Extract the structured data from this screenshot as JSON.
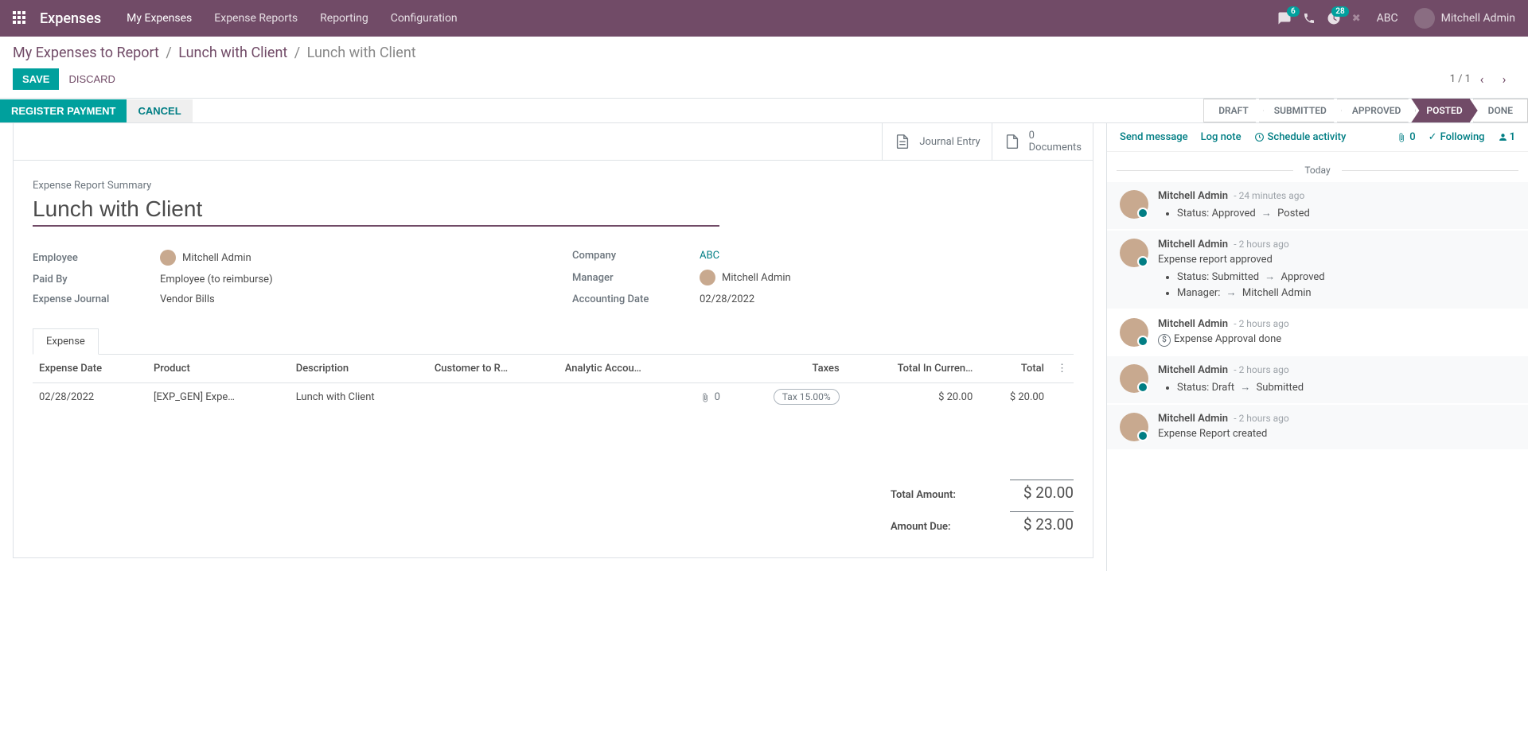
{
  "topnav": {
    "brand": "Expenses",
    "menu": [
      "My Expenses",
      "Expense Reports",
      "Reporting",
      "Configuration"
    ],
    "chat_badge": "6",
    "clock_badge": "28",
    "company": "ABC",
    "user": "Mitchell Admin"
  },
  "breadcrumb": {
    "root": "My Expenses to Report",
    "mid": "Lunch with Client",
    "current": "Lunch with Client"
  },
  "actions": {
    "save": "SAVE",
    "discard": "DISCARD",
    "pager": "1 / 1"
  },
  "statusbar": {
    "register": "REGISTER PAYMENT",
    "cancel": "CANCEL",
    "stages": [
      "DRAFT",
      "SUBMITTED",
      "APPROVED",
      "POSTED",
      "DONE"
    ],
    "active_stage": "POSTED"
  },
  "stat_buttons": {
    "journal": "Journal Entry",
    "docs_count": "0",
    "docs_label": "Documents"
  },
  "form": {
    "summary_label": "Expense Report Summary",
    "title": "Lunch with Client",
    "left": {
      "employee_label": "Employee",
      "employee_value": "Mitchell Admin",
      "paidby_label": "Paid By",
      "paidby_value": "Employee (to reimburse)",
      "journal_label": "Expense Journal",
      "journal_value": "Vendor Bills"
    },
    "right": {
      "company_label": "Company",
      "company_value": "ABC",
      "manager_label": "Manager",
      "manager_value": "Mitchell Admin",
      "accdate_label": "Accounting Date",
      "accdate_value": "02/28/2022"
    }
  },
  "tab_label": "Expense",
  "table": {
    "headers": {
      "date": "Expense Date",
      "product": "Product",
      "description": "Description",
      "customer": "Customer to R…",
      "analytic": "Analytic Accou…",
      "taxes": "Taxes",
      "total_currency": "Total In Curren…",
      "total": "Total"
    },
    "row": {
      "date": "02/28/2022",
      "product": "[EXP_GEN] Expe…",
      "description": "Lunch with Client",
      "attach": "0",
      "tax": "Tax 15.00%",
      "total_currency": "$ 20.00",
      "total": "$ 20.00"
    }
  },
  "totals": {
    "amount_label": "Total Amount:",
    "amount_value": "$ 20.00",
    "due_label": "Amount Due:",
    "due_value": "$ 23.00"
  },
  "chatter": {
    "send": "Send message",
    "log": "Log note",
    "schedule": "Schedule activity",
    "attach_count": "0",
    "following": "Following",
    "followers": "1",
    "today": "Today",
    "messages": [
      {
        "author": "Mitchell Admin",
        "time": "- 24 minutes ago",
        "type": "status",
        "items": [
          {
            "label": "Status:",
            "from": "Approved",
            "to": "Posted"
          }
        ]
      },
      {
        "author": "Mitchell Admin",
        "time": "- 2 hours ago",
        "type": "status_with_body",
        "body": "Expense report approved",
        "items": [
          {
            "label": "Status:",
            "from": "Submitted",
            "to": "Approved"
          },
          {
            "label": "Manager:",
            "from": "",
            "to": "Mitchell Admin"
          }
        ]
      },
      {
        "author": "Mitchell Admin",
        "time": "- 2 hours ago",
        "type": "activity",
        "body": "Expense Approval done"
      },
      {
        "author": "Mitchell Admin",
        "time": "- 2 hours ago",
        "type": "status",
        "items": [
          {
            "label": "Status:",
            "from": "Draft",
            "to": "Submitted"
          }
        ]
      },
      {
        "author": "Mitchell Admin",
        "time": "- 2 hours ago",
        "type": "plain",
        "body": "Expense Report created"
      }
    ]
  }
}
